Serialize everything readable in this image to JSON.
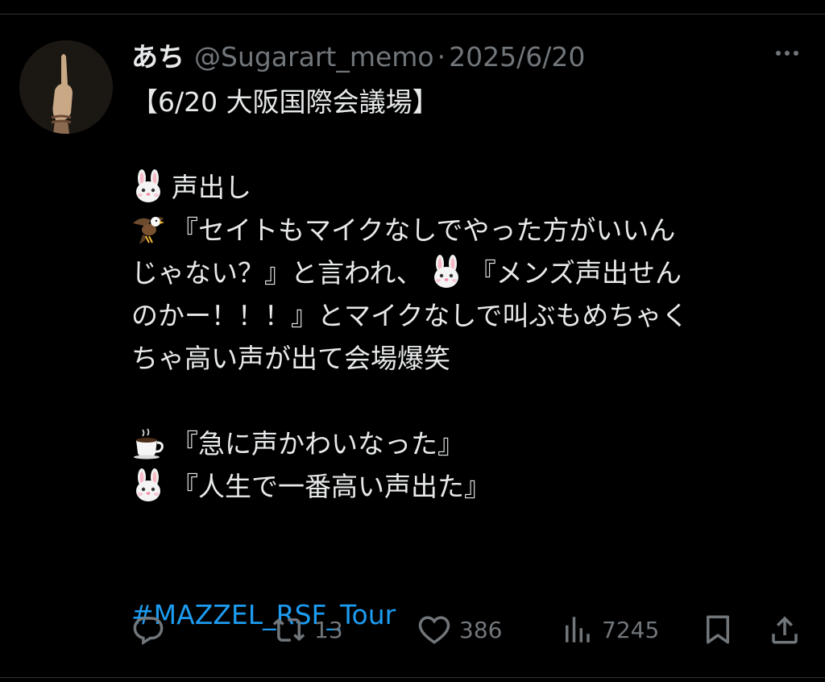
{
  "tweet": {
    "display_name": "あち",
    "handle": "@Sugarart_memo",
    "separator": "·",
    "date": "2025/6/20",
    "lines": [
      "【6/20 大阪国際会議場】",
      "",
      "声出し",
      "『セイトもマイクなしでやった方がいいん",
      "じゃない？』と言われ、",
      "『メンズ声出せん",
      "のかー！！！』とマイクなしで叫ぶもめちゃく",
      "ちゃ高い声が出て会場爆笑",
      "",
      "『急に声かわいなった』",
      "『人生で一番高い声出た』",
      ""
    ],
    "hashtag": "#MAZZEL_RSF_Tour",
    "emoji": {
      "rabbit": "rabbit-face-emoji",
      "eagle": "eagle-emoji",
      "coffee": "hot-beverage-emoji"
    }
  },
  "actions": {
    "reply": {
      "icon": "reply-icon",
      "count": ""
    },
    "retweet": {
      "icon": "retweet-icon",
      "count": "13"
    },
    "like": {
      "icon": "heart-icon",
      "count": "386"
    },
    "views": {
      "icon": "analytics-icon",
      "count": "7245"
    },
    "bookmark": {
      "icon": "bookmark-icon"
    },
    "share": {
      "icon": "share-icon"
    }
  },
  "colors": {
    "background": "#000000",
    "text": "#e7e9ea",
    "muted": "#71767b",
    "link": "#1d9bf0",
    "divider": "#2f3336"
  }
}
